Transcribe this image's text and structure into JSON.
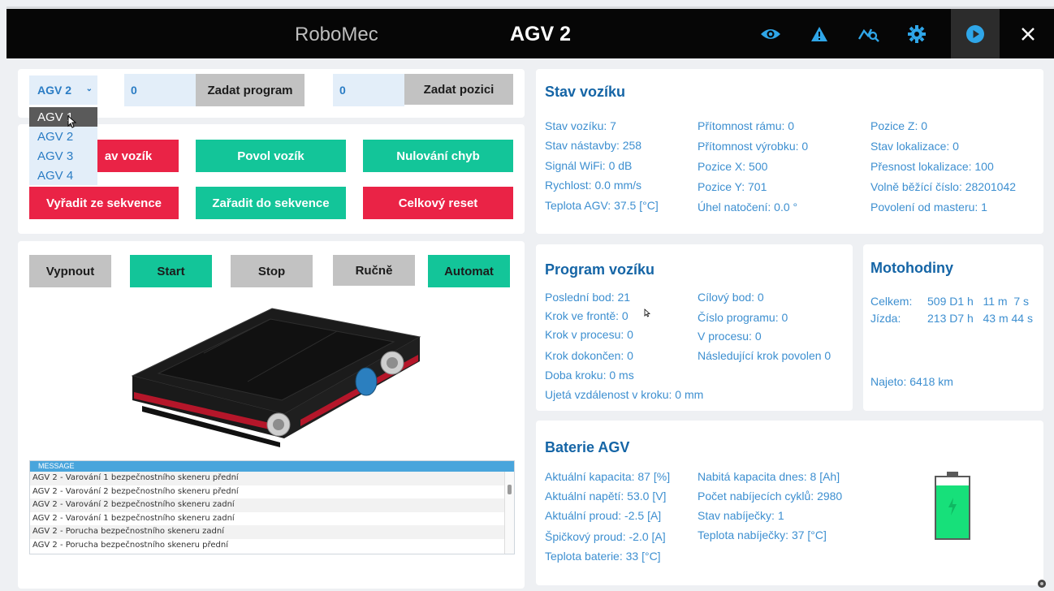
{
  "header": {
    "app_name": "RoboMec",
    "title": "AGV 2",
    "icons": [
      "eye-icon",
      "warning-icon",
      "chart-icon",
      "gear-icon",
      "play-icon",
      "close-icon"
    ]
  },
  "controls": {
    "agv_select": {
      "value": "AGV 2",
      "options": [
        "AGV 1",
        "AGV 2",
        "AGV 3",
        "AGV 4"
      ],
      "hovered": "AGV 1"
    },
    "program_input": "0",
    "program_button": "Zadat program",
    "position_input": "0",
    "position_button": "Zadat pozici"
  },
  "actions": {
    "stop_vehicle_partial": "av vozík",
    "enable_vehicle": "Povol vozík",
    "reset_errors": "Nulování chyb",
    "remove_from_sequence": "Vyřadit ze sekvence",
    "add_to_sequence": "Zařadit do sekvence",
    "total_reset": "Celkový reset"
  },
  "modes": {
    "off": "Vypnout",
    "start": "Start",
    "stop": "Stop",
    "manual": "Ručně",
    "automat": "Automat"
  },
  "log": {
    "header": "MESSAGE",
    "rows": [
      "AGV 2 - Varování 1 bezpečnostního skeneru přední",
      "AGV 2 - Varování 2 bezpečnostního skeneru přední",
      "AGV 2 - Varování 2 bezpečnostního skeneru zadní",
      "AGV 2 - Varování 1 bezpečnostního skeneru zadní",
      "AGV 2 - Porucha bezpečnostního skeneru zadní",
      "AGV 2 - Porucha bezpečnostního skeneru přední"
    ]
  },
  "status": {
    "title": "Stav vozíku",
    "col1": [
      "Stav vozíku: 7",
      "Stav nástavby: 258",
      "Signál WiFi: 0 dB",
      "Rychlost: 0.0 mm/s",
      "Teplota AGV: 37.5 [°C]"
    ],
    "col2": [
      "Přítomnost rámu: 0",
      "Přítomnost výrobku: 0",
      "Pozice X: 500",
      "Pozice Y: 701",
      "Úhel natočení: 0.0 °"
    ],
    "col3": [
      "Pozice Z: 0",
      "Stav lokalizace: 0",
      "Přesnost lokalizace: 100",
      "Volně běžící číslo: 28201042",
      "Povolení od masteru: 1"
    ]
  },
  "program": {
    "title": "Program vozíku",
    "col1": [
      "Poslední bod: 21",
      "Krok ve frontě: 0",
      "Krok v procesu: 0",
      "Krok dokončen: 0",
      "Doba kroku: 0 ms",
      "Ujetá vzdálenost v kroku: 0 mm"
    ],
    "col2": [
      "Cílový bod: 0",
      "Číslo programu: 0",
      "V procesu: 0",
      "Následující krok povolen 0"
    ]
  },
  "motohours": {
    "title": "Motohodiny",
    "total_label": "Celkem:",
    "total_value": "509 D1 h   11 m  7 s",
    "drive_label": "Jízda:",
    "drive_value": "213 D7 h   43 m 44 s",
    "driven": "Najeto: 6418 km"
  },
  "battery": {
    "title": "Baterie AGV",
    "col1": [
      "Aktuální kapacita: 87 [%]",
      "Aktuální napětí: 53.0 [V]",
      "Aktuální proud: -2.5 [A]",
      "Špičkový proud: -2.0 [A]",
      "Teplota baterie: 33 [°C]"
    ],
    "col2": [
      "Nabitá kapacita dnes: 8 [Ah]",
      "Počet nabíjecích cyklů: 2980",
      "Stav nabíječky: 1",
      "Teplota nabíječky: 37 [°C]"
    ],
    "level_percent": 87,
    "colors": {
      "fill": "#17e07a",
      "frame": "#5a5a5a"
    }
  },
  "colors": {
    "accent_blue": "#2a7cc4",
    "red": "#ea2346",
    "green": "#13c599",
    "grey": "#c2c2c2"
  }
}
